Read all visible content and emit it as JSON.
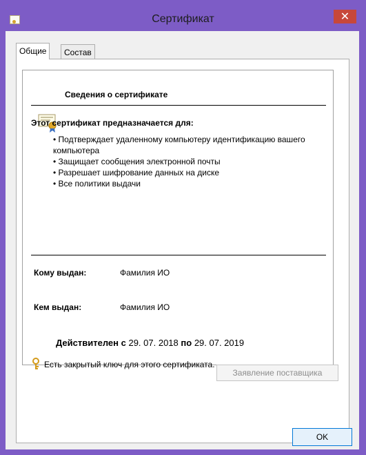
{
  "window": {
    "title": "Сертификат",
    "close": "✕",
    "accent": "#7d5cc6"
  },
  "tabs": [
    {
      "label": "Общие",
      "active": true
    },
    {
      "label": "Состав",
      "active": false
    }
  ],
  "info": {
    "header": "Сведения о сертификате",
    "purpose_title": "Этот сертификат предназначается для:",
    "purposes": [
      "• Подтверждает удаленному компьютеру идентификацию вашего компьютера",
      "• Защищает сообщения электронной почты",
      "• Разрешает шифрование данных на диске",
      "• Все политики выдачи"
    ],
    "issued_to_label": "Кому выдан:",
    "issued_to_value": "Фамилия ИО",
    "issued_by_label": "Кем выдан:",
    "issued_by_value": "Фамилия ИО",
    "valid_from_label": "Действителен с",
    "valid_from": "29. 07. 2018",
    "valid_to_label": "по",
    "valid_to": "29. 07. 2019",
    "private_key_text": "Есть закрытый ключ для этого сертификата."
  },
  "buttons": {
    "issuer_statement": "Заявление поставщика",
    "ok": "OK"
  }
}
